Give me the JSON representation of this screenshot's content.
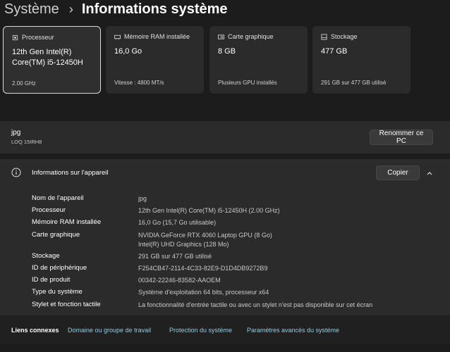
{
  "breadcrumb": {
    "parent": "Système",
    "separator": "›",
    "current": "Informations système"
  },
  "cards": [
    {
      "title": "Processeur",
      "icon": "cpu-icon",
      "value": "12th Gen Intel(R) Core(TM) i5-12450H",
      "sub": "2.00 GHz",
      "selected": true
    },
    {
      "title": "Mémoire RAM installée",
      "icon": "ram-icon",
      "value": "16,0 Go",
      "sub": "Vitesse : 4800 MT/s"
    },
    {
      "title": "Carte graphique",
      "icon": "gpu-icon",
      "value": "8 GB",
      "sub": "Plusieurs GPU installés"
    },
    {
      "title": "Stockage",
      "icon": "storage-icon",
      "value": "477 GB",
      "sub": "291 GB sur 477 GB utilisé"
    }
  ],
  "pc": {
    "name": "jpg",
    "model": "LOQ 15IRH8",
    "rename_label": "Renommer ce PC"
  },
  "device_info": {
    "title": "Informations sur l'appareil",
    "copy_label": "Copier",
    "rows": [
      {
        "label": "Nom de l'appareil",
        "value": "jpg"
      },
      {
        "label": "Processeur",
        "value": "12th Gen Intel(R) Core(TM) i5-12450H (2.00 GHz)"
      },
      {
        "label": "Mémoire RAM installée",
        "value": "16,0 Go (15,7 Go utilisable)"
      },
      {
        "label": "Carte graphique",
        "value": "NVIDIA GeForce RTX 4060 Laptop GPU (8 Go)",
        "value2": "Intel(R) UHD Graphics (128 Mo)"
      },
      {
        "label": "Stockage",
        "value": "291 GB sur 477 GB utilisé"
      },
      {
        "label": "ID de périphérique",
        "value": "F254CB47-2114-4C33-82E9-D1D4DB9272B9"
      },
      {
        "label": "ID de produit",
        "value": "00342-22246-83582-AAOEM"
      },
      {
        "label": "Type du système",
        "value": "Système d'exploitation 64 bits, processeur x64"
      },
      {
        "label": "Stylet et fonction tactile",
        "value": "La fonctionnalité d'entrée tactile ou avec un stylet n'est pas disponible sur cet écran"
      }
    ]
  },
  "related_links": {
    "label": "Liens connexes",
    "links": [
      "Domaine ou groupe de travail",
      "Protection du système",
      "Paramètres avancés du système"
    ]
  },
  "colors": {
    "background": "#1c1c1c",
    "panel": "#2b2b2b",
    "link": "#7fd3f5"
  }
}
